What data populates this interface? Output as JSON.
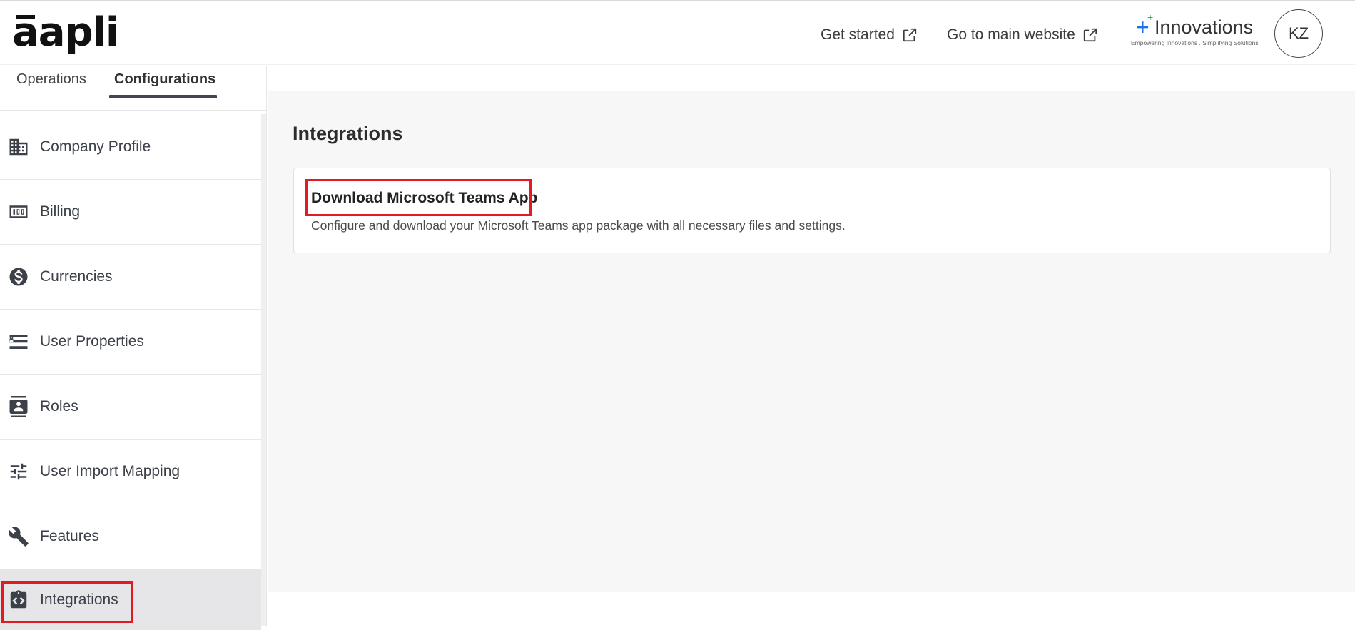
{
  "header": {
    "logo_text": "aapli",
    "links": [
      {
        "label": "Get started",
        "icon": "external-link-icon"
      },
      {
        "label": "Go to main website",
        "icon": "external-link-icon"
      }
    ],
    "brand": {
      "name": "Innovations",
      "tagline": "Empowering Innovations . Simplifying Solutions"
    },
    "avatar_initials": "KZ"
  },
  "sidebar": {
    "tabs": [
      {
        "label": "Operations",
        "active": false
      },
      {
        "label": "Configurations",
        "active": true
      }
    ],
    "items": [
      {
        "label": "Company Profile",
        "icon": "building-icon"
      },
      {
        "label": "Billing",
        "icon": "billing-icon"
      },
      {
        "label": "Currencies",
        "icon": "dollar-circle-icon"
      },
      {
        "label": "User Properties",
        "icon": "list-icon"
      },
      {
        "label": "Roles",
        "icon": "contact-card-icon"
      },
      {
        "label": "User Import Mapping",
        "icon": "sliders-icon"
      },
      {
        "label": "Features",
        "icon": "wrench-icon"
      },
      {
        "label": "Integrations",
        "icon": "code-clipboard-icon",
        "active": true
      }
    ]
  },
  "main": {
    "title": "Integrations",
    "card": {
      "title": "Download Microsoft Teams App",
      "description": "Configure and download your Microsoft Teams app package with all necessary files and settings."
    }
  },
  "colors": {
    "highlight": "#e01b24",
    "accent_dark": "#40454f",
    "brand_blue": "#1a73e8"
  }
}
